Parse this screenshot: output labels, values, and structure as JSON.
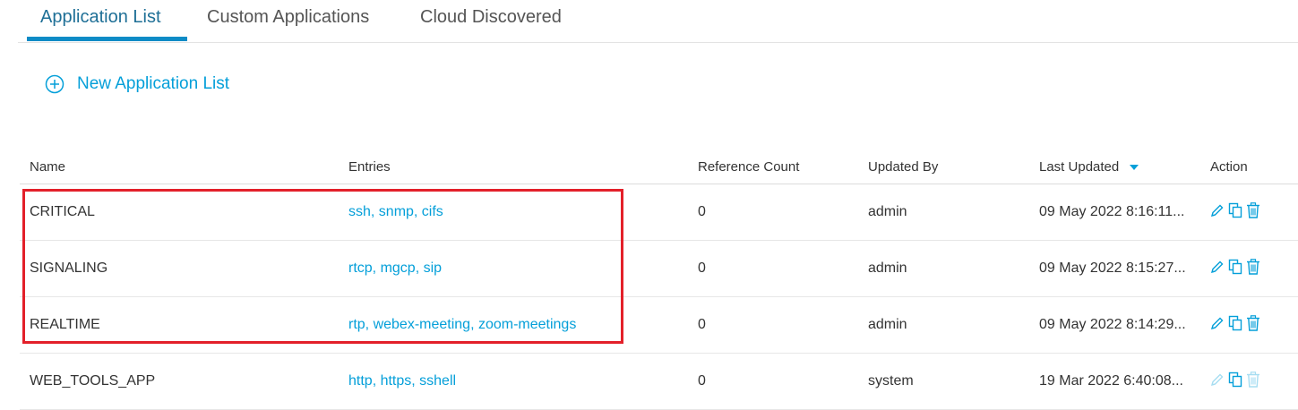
{
  "tabs": [
    {
      "label": "Application List",
      "active": true
    },
    {
      "label": "Custom Applications",
      "active": false
    },
    {
      "label": "Cloud Discovered",
      "active": false
    }
  ],
  "new_button": {
    "label": "New Application List",
    "icon": "plus-circle-icon"
  },
  "table": {
    "columns": [
      "Name",
      "Entries",
      "Reference Count",
      "Updated By",
      "Last Updated",
      "Action"
    ],
    "sort_column": "Last Updated",
    "sort_direction": "descending",
    "rows": [
      {
        "name": "CRITICAL",
        "entries": "ssh, snmp, cifs",
        "reference_count": "0",
        "updated_by": "admin",
        "last_updated": "09 May 2022 8:16:11...",
        "editable": true
      },
      {
        "name": "SIGNALING",
        "entries": "rtcp, mgcp, sip",
        "reference_count": "0",
        "updated_by": "admin",
        "last_updated": "09 May 2022 8:15:27...",
        "editable": true
      },
      {
        "name": "REALTIME",
        "entries": "rtp, webex-meeting, zoom-meetings",
        "reference_count": "0",
        "updated_by": "admin",
        "last_updated": "09 May 2022 8:14:29...",
        "editable": true
      },
      {
        "name": "WEB_TOOLS_APP",
        "entries": "http, https, sshell",
        "reference_count": "0",
        "updated_by": "system",
        "last_updated": "19 Mar 2022 6:40:08...",
        "editable": false
      }
    ]
  },
  "colors": {
    "accent": "#049fd9",
    "tab_underline": "#0d8bc6",
    "highlight": "#e3202a"
  }
}
